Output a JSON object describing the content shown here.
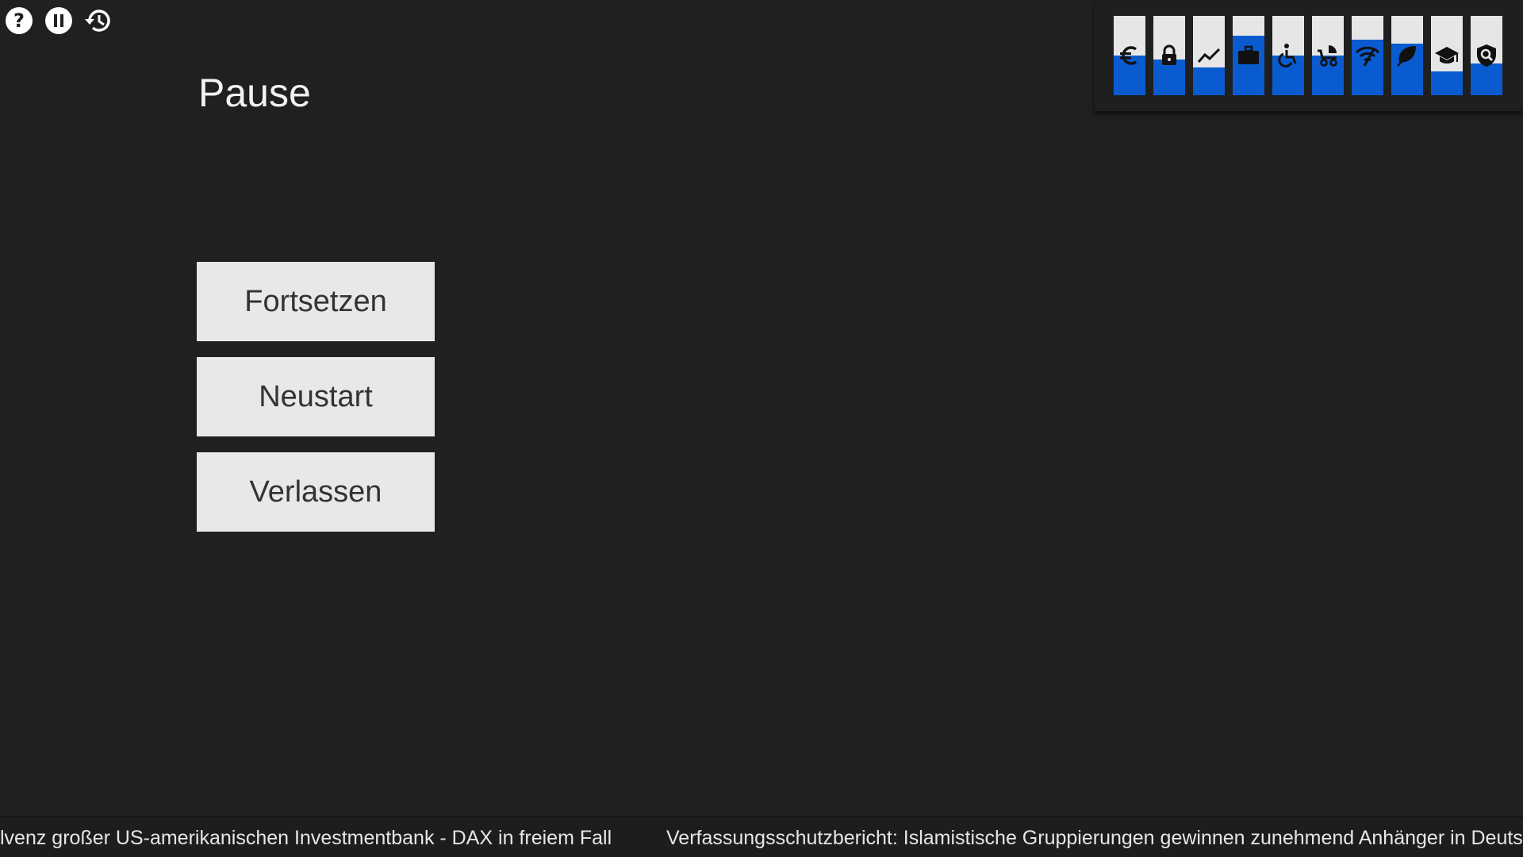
{
  "toolbar": {
    "icons": [
      "help-icon",
      "pause-icon",
      "history-icon"
    ]
  },
  "pause_menu": {
    "title": "Pause",
    "buttons": [
      {
        "label": "Fortsetzen"
      },
      {
        "label": "Neustart"
      },
      {
        "label": "Verlassen"
      }
    ]
  },
  "stats": {
    "accent_color": "#0a5bcf",
    "track_color": "#e6e6e6",
    "items": [
      {
        "icon": "euro-icon",
        "fill": 0.5
      },
      {
        "icon": "lock-icon",
        "fill": 0.45
      },
      {
        "icon": "trend-icon",
        "fill": 0.35
      },
      {
        "icon": "briefcase-icon",
        "fill": 0.75
      },
      {
        "icon": "wheelchair-icon",
        "fill": 0.5
      },
      {
        "icon": "stroller-icon",
        "fill": 0.5
      },
      {
        "icon": "wifi-icon",
        "fill": 0.7
      },
      {
        "icon": "leaf-icon",
        "fill": 0.65
      },
      {
        "icon": "graduation-cap-icon",
        "fill": 0.3
      },
      {
        "icon": "security-search-icon",
        "fill": 0.4
      }
    ]
  },
  "ticker": {
    "items": [
      "lvenz großer US-amerikanischen Investmentbank - DAX in freiem Fall",
      "Verfassungsschutzbericht: Islamistische Gruppierungen gewinnen zunehmend Anhänger in Deutsc"
    ]
  }
}
